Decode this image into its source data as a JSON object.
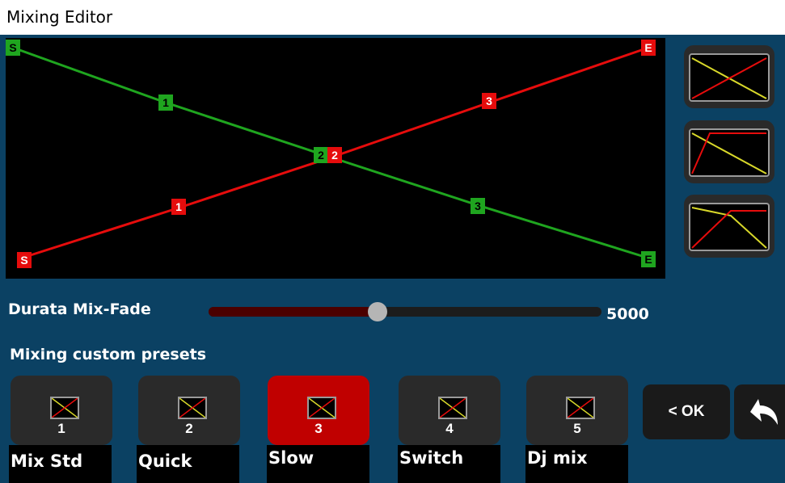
{
  "window": {
    "title": "Mixing Editor"
  },
  "colors": {
    "green": "#1fa51f",
    "red": "#e60c0c",
    "yellow": "#d8d82a",
    "active_preset": "#c00000"
  },
  "editor": {
    "fade_out_points": [
      "S",
      "1",
      "2",
      "3",
      "E"
    ],
    "fade_in_points": [
      "S",
      "1",
      "2",
      "3",
      "E"
    ]
  },
  "curve_buttons": [
    {
      "name": "crossfade-linear-curve"
    },
    {
      "name": "crossfade-quick-in-curve"
    },
    {
      "name": "crossfade-knee-curve"
    }
  ],
  "duration": {
    "label": "Durata Mix-Fade",
    "value": "5000",
    "fraction": 0.43
  },
  "presets": {
    "label": "Mixing custom presets",
    "items": [
      {
        "number": "1",
        "name": "Mix Std",
        "active": false
      },
      {
        "number": "2",
        "name": "Quick",
        "active": false
      },
      {
        "number": "3",
        "name": "Slow",
        "active": true
      },
      {
        "number": "4",
        "name": "Switch",
        "active": false
      },
      {
        "number": "5",
        "name": "Dj mix",
        "active": false
      }
    ]
  },
  "actions": {
    "ok_label": "< OK",
    "back_icon": "back-arrow-icon"
  }
}
